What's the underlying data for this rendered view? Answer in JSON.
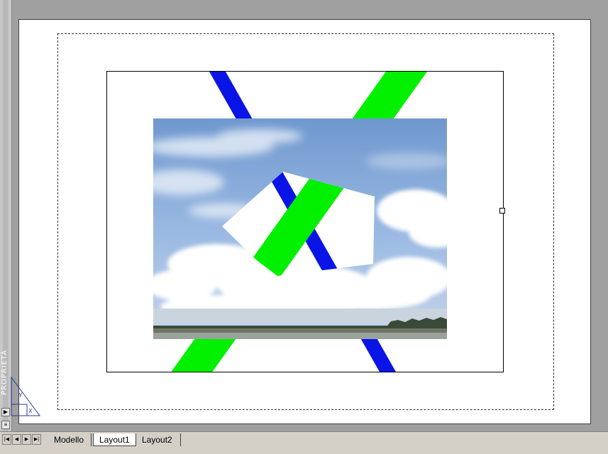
{
  "tabs": {
    "model": "Modello",
    "layout1": "Layout1",
    "layout2": "Layout2",
    "active": "Layout1"
  },
  "palette": {
    "label": "PROPRIETÀ"
  },
  "colors": {
    "background": "#a0a0a0",
    "paper": "#ffffff",
    "stripe_blue": "#0a14e6",
    "stripe_green": "#00f000",
    "sky_top": "#6f98cf",
    "sky_bottom": "#b9cde8"
  },
  "icons": {
    "nav_first": "first-tab-icon",
    "nav_prev": "previous-tab-icon",
    "nav_next": "next-tab-icon",
    "nav_last": "last-tab-icon",
    "ucs": "ucs-icon",
    "grip": "grip-handle-icon"
  }
}
